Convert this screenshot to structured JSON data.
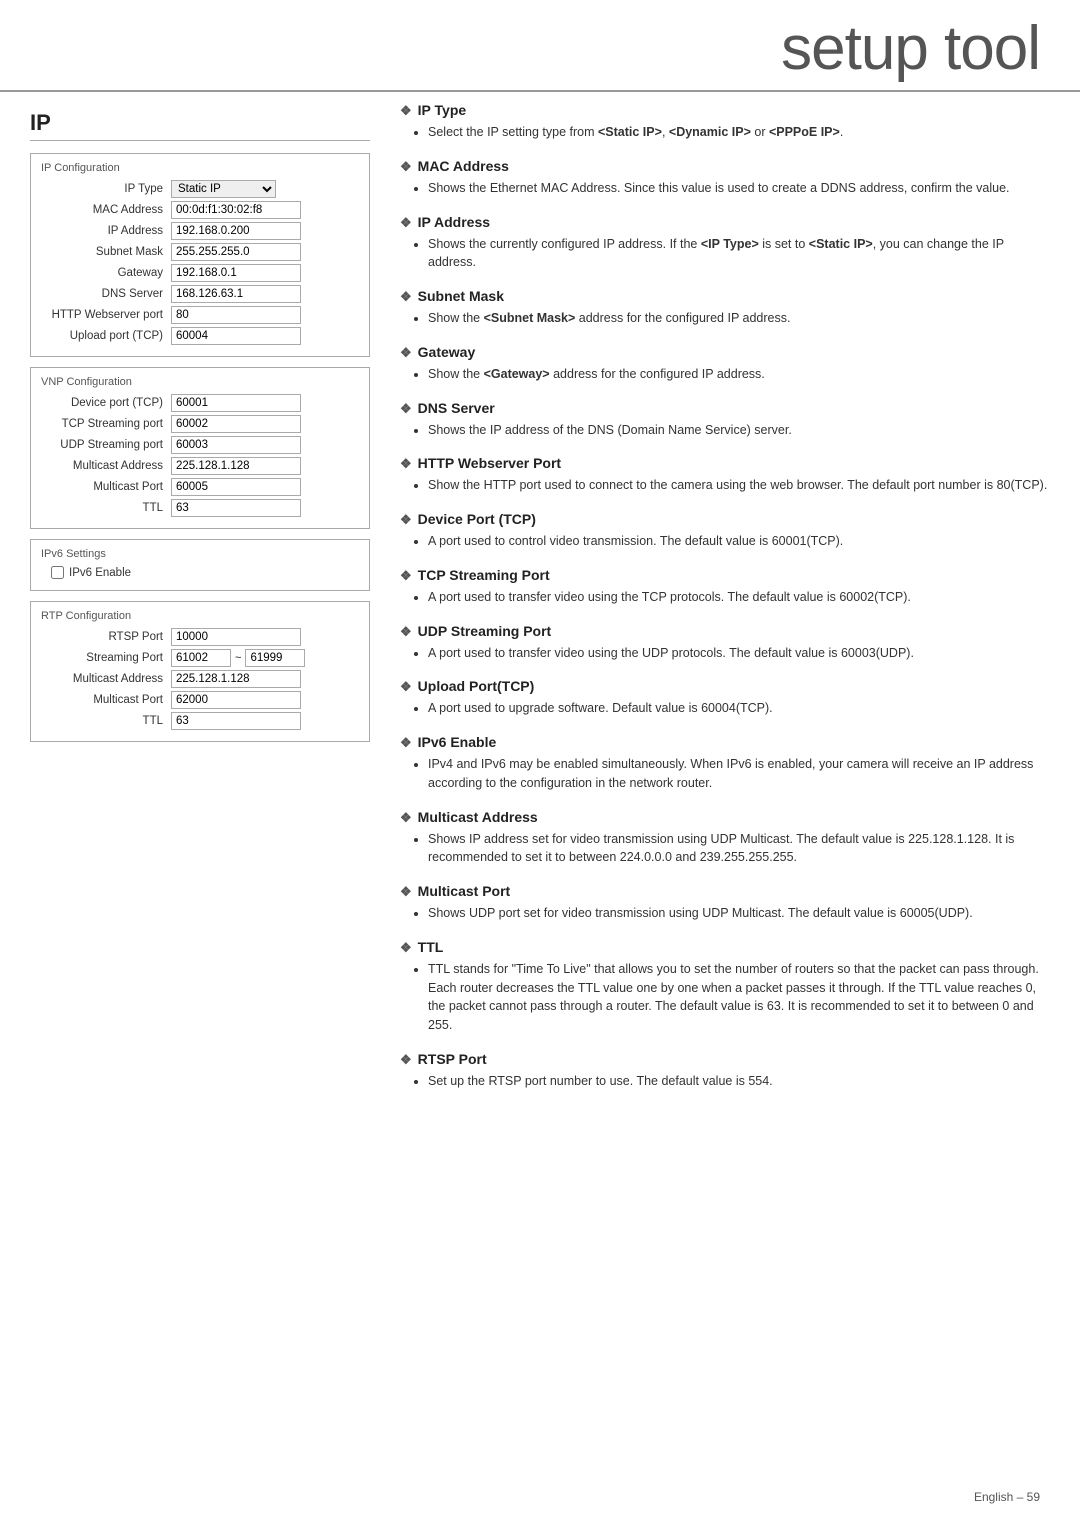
{
  "header": {
    "title": "setup tool"
  },
  "page": {
    "section": "IP",
    "footer": "English – 59"
  },
  "ip_config": {
    "panel_title": "IP Configuration",
    "fields": [
      {
        "label": "IP Type",
        "value": "Static IP",
        "type": "select"
      },
      {
        "label": "MAC Address",
        "value": "00:0d:f1:30:02:f8",
        "type": "text"
      },
      {
        "label": "IP Address",
        "value": "192.168.0.200",
        "type": "text"
      },
      {
        "label": "Subnet Mask",
        "value": "255.255.255.0",
        "type": "text"
      },
      {
        "label": "Gateway",
        "value": "192.168.0.1",
        "type": "text"
      },
      {
        "label": "DNS Server",
        "value": "168.126.63.1",
        "type": "text"
      },
      {
        "label": "HTTP Webserver port",
        "value": "80",
        "type": "text"
      },
      {
        "label": "Upload port (TCP)",
        "value": "60004",
        "type": "text"
      }
    ]
  },
  "vnp_config": {
    "panel_title": "VNP Configuration",
    "fields": [
      {
        "label": "Device port (TCP)",
        "value": "60001",
        "type": "text"
      },
      {
        "label": "TCP Streaming port",
        "value": "60002",
        "type": "text"
      },
      {
        "label": "UDP Streaming port",
        "value": "60003",
        "type": "text"
      },
      {
        "label": "Multicast Address",
        "value": "225.128.1.128",
        "type": "text"
      },
      {
        "label": "Multicast Port",
        "value": "60005",
        "type": "text"
      },
      {
        "label": "TTL",
        "value": "63",
        "type": "text"
      }
    ]
  },
  "ipv6_config": {
    "panel_title": "IPv6 Settings",
    "checkbox_label": "IPv6 Enable"
  },
  "rtp_config": {
    "panel_title": "RTP Configuration",
    "fields": [
      {
        "label": "RTSP Port",
        "value": "10000",
        "type": "text"
      },
      {
        "label": "Streaming Port",
        "value_from": "61002",
        "value_to": "61999",
        "type": "range"
      },
      {
        "label": "Multicast Address",
        "value": "225.128.1.128",
        "type": "text"
      },
      {
        "label": "Multicast Port",
        "value": "62000",
        "type": "text"
      },
      {
        "label": "TTL",
        "value": "63",
        "type": "text"
      }
    ]
  },
  "topics": [
    {
      "id": "ip-type",
      "title": "IP Type",
      "bullets": [
        "Select the IP setting type from <Static IP>, <Dynamic IP> or <PPPoE IP>."
      ]
    },
    {
      "id": "mac-address",
      "title": "MAC Address",
      "bullets": [
        "Shows the Ethernet MAC Address. Since this value is used to create a DDNS address, confirm the value."
      ]
    },
    {
      "id": "ip-address",
      "title": "IP Address",
      "bullets": [
        "Shows the currently configured IP address. If the <IP Type> is set to <Static IP>, you can change the IP address."
      ]
    },
    {
      "id": "subnet-mask",
      "title": "Subnet Mask",
      "bullets": [
        "Show the <Subnet Mask> address for the configured IP address."
      ]
    },
    {
      "id": "gateway",
      "title": "Gateway",
      "bullets": [
        "Show the <Gateway> address for the configured IP address."
      ]
    },
    {
      "id": "dns-server",
      "title": "DNS Server",
      "bullets": [
        "Shows the IP address of the DNS (Domain Name Service) server."
      ]
    },
    {
      "id": "http-webserver-port",
      "title": "HTTP Webserver Port",
      "bullets": [
        "Show the HTTP port used to connect to the camera using the web browser. The default port number is 80(TCP)."
      ]
    },
    {
      "id": "device-port-tcp",
      "title": "Device Port (TCP)",
      "bullets": [
        "A port used to control video transmission. The default value is 60001(TCP)."
      ]
    },
    {
      "id": "tcp-streaming-port",
      "title": "TCP Streaming Port",
      "bullets": [
        "A port used to transfer video using the TCP protocols. The default value is 60002(TCP)."
      ]
    },
    {
      "id": "udp-streaming-port",
      "title": "UDP Streaming Port",
      "bullets": [
        "A port used to transfer video using the UDP protocols. The default value is 60003(UDP)."
      ]
    },
    {
      "id": "upload-port-tcp",
      "title": "Upload Port(TCP)",
      "bullets": [
        "A port used to upgrade software. Default value is 60004(TCP)."
      ]
    },
    {
      "id": "ipv6-enable",
      "title": "IPv6 Enable",
      "bullets": [
        "IPv4 and IPv6 may be enabled simultaneously. When IPv6 is enabled, your camera will receive an IP address according to the configuration in the network router."
      ]
    },
    {
      "id": "multicast-address",
      "title": "Multicast Address",
      "bullets": [
        "Shows IP address set for video transmission using UDP Multicast. The default value is 225.128.1.128. It is recommended to set it to between 224.0.0.0 and 239.255.255.255."
      ]
    },
    {
      "id": "multicast-port",
      "title": "Multicast Port",
      "bullets": [
        "Shows UDP port set for video transmission using UDP Multicast. The default value is 60005(UDP)."
      ]
    },
    {
      "id": "ttl",
      "title": "TTL",
      "bullets": [
        "TTL stands for \"Time To Live\" that allows you to set the number of routers so that the packet can pass through. Each router decreases the TTL value one by one when a packet passes it through. If the TTL value reaches 0, the packet cannot pass through a router. The default value is 63. It is recommended to set it to between 0 and 255."
      ]
    },
    {
      "id": "rtsp-port",
      "title": "RTSP Port",
      "bullets": [
        "Set up the RTSP port number to use. The default value is 554."
      ]
    }
  ]
}
